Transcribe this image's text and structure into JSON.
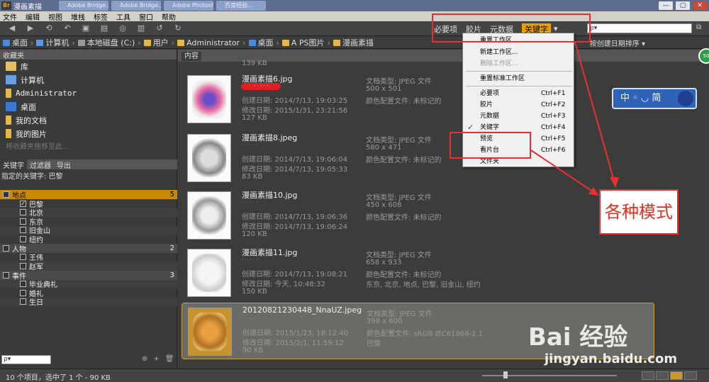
{
  "window": {
    "title": "漫画素描",
    "tabs": [
      "Adobe Bridge...",
      "Adobe Bridge...",
      "Adobe Photoshop...",
      "百度经验..."
    ],
    "buttons": [
      "—",
      "▢",
      "✕"
    ]
  },
  "menu": [
    "文件",
    "编辑",
    "视图",
    "堆栈",
    "标签",
    "工具",
    "窗口",
    "帮助"
  ],
  "workspace": {
    "items": [
      "必要项",
      "胶片",
      "元数据"
    ],
    "active": "关键字",
    "search_placeholder": "ρ▾"
  },
  "path": {
    "crumbs": [
      "桌面",
      "计算机",
      "本地磁盘 (C:)",
      "用户",
      "Administrator",
      "桌面",
      "A PS图片",
      "漫画素描"
    ],
    "sort": "按创建日期排序 ▾"
  },
  "favorites": {
    "tab": "收藏夹",
    "items": [
      "库",
      "计算机",
      "Administrator",
      "桌面",
      "我的文档",
      "我的图片"
    ],
    "hint": "将收藏夹拖移至此..."
  },
  "keywords": {
    "tabs": [
      "关键字",
      "过滤器",
      "导出"
    ],
    "assigned": "指定的关键字: 巴黎",
    "groups": [
      {
        "name": "地点",
        "count": "5",
        "items": [
          "巴黎",
          "北京",
          "东京",
          "旧金山",
          "纽约"
        ]
      },
      {
        "name": "人物",
        "count": "2",
        "items": [
          "王伟",
          "赵军"
        ]
      },
      {
        "name": "事件",
        "count": "3",
        "items": [
          "毕业典礼",
          "婚礼",
          "生日"
        ]
      }
    ],
    "search_placeholder": "ρ▾"
  },
  "content": {
    "tab": "内容",
    "partial_size": "139 KB",
    "files": [
      {
        "name": "漫画素描6.jpg",
        "dots": "· · · · ·",
        "created": "创建日期: 2014/7/13, 19:03:25",
        "modified": "修改日期: 2015/1/31, 23:21:56",
        "size": "127 KB",
        "type": "文档类型: JPEG 文件",
        "dims": "500 x 501",
        "profile": "颜色配置文件: 未标记的",
        "extra": ""
      },
      {
        "name": "漫画素描8.jpeg",
        "dots": "· · · · ·",
        "created": "创建日期: 2014/7/13, 19:06:04",
        "modified": "修改日期: 2014/7/13, 19:05:33",
        "size": "83 KB",
        "type": "文档类型: JPEG 文件",
        "dims": "580 x 471",
        "profile": "颜色配置文件: 未标记的",
        "extra": ""
      },
      {
        "name": "漫画素描10.jpg",
        "dots": "· · · · ·",
        "created": "创建日期: 2014/7/13, 19:06:36",
        "modified": "修改日期: 2014/7/13, 19:06:24",
        "size": "120 KB",
        "type": "文档类型: JPEG 文件",
        "dims": "450 x 608",
        "profile": "颜色配置文件: 未标记的",
        "extra": ""
      },
      {
        "name": "漫画素描11.jpg",
        "dots": "· · · · ·",
        "created": "创建日期: 2014/7/13, 19:08:21",
        "modified": "修改日期: 今天, 10:48:32",
        "size": "150 KB",
        "type": "文档类型: JPEG 文件",
        "dims": "658 x 933",
        "profile": "颜色配置文件: 未标记的",
        "extra": "东京, 北京, 地点, 巴黎, 旧金山, 纽约"
      },
      {
        "name": "20120821230448_NnaUZ.jpeg",
        "dots": "· · · · ·",
        "created": "创建日期: 2015/1/23, 18:12:40",
        "modified": "修改日期: 2015/2/1, 11:59:12",
        "size": "90 KB",
        "type": "文档类型: JPEG 文件",
        "dims": "398 x 600",
        "profile": "颜色配置文件: sRGB IEC61966-2.1",
        "extra": "巴黎"
      }
    ]
  },
  "dropdown": {
    "items": [
      {
        "label": "重置工作区",
        "sc": "",
        "disabled": false
      },
      {
        "label": "新建工作区...",
        "sc": "",
        "disabled": false
      },
      {
        "label": "删除工作区...",
        "sc": "",
        "disabled": true
      },
      {
        "label": "重置标准工作区",
        "sc": "",
        "disabled": false
      },
      {
        "label": "必要项",
        "sc": "Ctrl+F1",
        "disabled": false
      },
      {
        "label": "胶片",
        "sc": "Ctrl+F2",
        "disabled": false
      },
      {
        "label": "元数据",
        "sc": "Ctrl+F3",
        "disabled": false
      },
      {
        "label": "关键字",
        "sc": "Ctrl+F4",
        "disabled": false
      },
      {
        "label": "预览",
        "sc": "Ctrl+F5",
        "disabled": false
      },
      {
        "label": "看片台",
        "sc": "Ctrl+F6",
        "disabled": false
      },
      {
        "label": "文件夹",
        "sc": "",
        "disabled": false
      }
    ],
    "check": "✓"
  },
  "annotation": {
    "callout": "各种模式"
  },
  "ime": {
    "label": "中 ◦ ◡ 简",
    "badge": "50"
  },
  "status": {
    "text": "10 个项目，选中了 1 个 - 90 KB"
  },
  "watermark": {
    "brand": "Bai 经验",
    "url": "jingyan.baidu.com"
  },
  "colors": {
    "accent": "#e8a000",
    "annotation": "#e83030",
    "selected_border": "#c8a040"
  }
}
